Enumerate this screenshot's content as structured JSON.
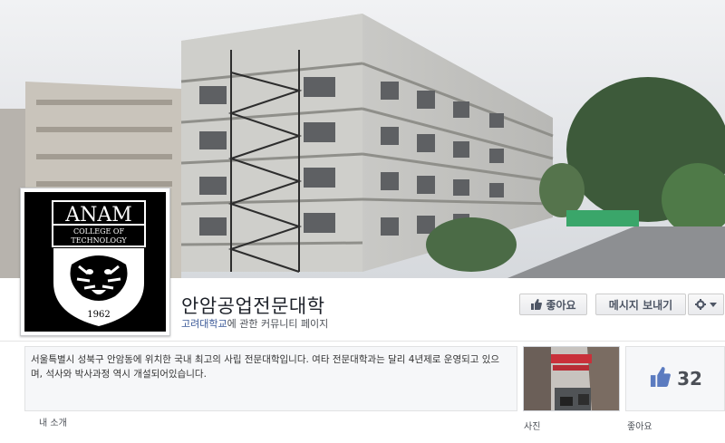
{
  "page": {
    "name": "안암공업전문대학",
    "community_prefix": "고려대학교",
    "community_suffix": "에 관한 커뮤니티 페이지"
  },
  "actions": {
    "like_label": "좋아요",
    "message_label": "메시지 보내기"
  },
  "logo": {
    "title": "ANAM",
    "line1": "COLLEGE OF",
    "line2": "TECHNOLOGY",
    "year": "1962"
  },
  "about": {
    "text": "서울특별시 성북구 안암동에 위치한 국내 최고의 사립 전문대학입니다. 여타 전문대학과는 달리 4년제로 운영되고 있으며, 석사와 박사과정 역시 개설되어있습니다.",
    "label": "내 소개"
  },
  "photos": {
    "label": "사진"
  },
  "likes": {
    "count": "32",
    "label": "좋아요"
  },
  "colors": {
    "link": "#3b5998",
    "button_text": "#4e5665"
  },
  "icons": [
    "thumbs-up-icon",
    "gear-icon",
    "chevron-down-icon"
  ]
}
